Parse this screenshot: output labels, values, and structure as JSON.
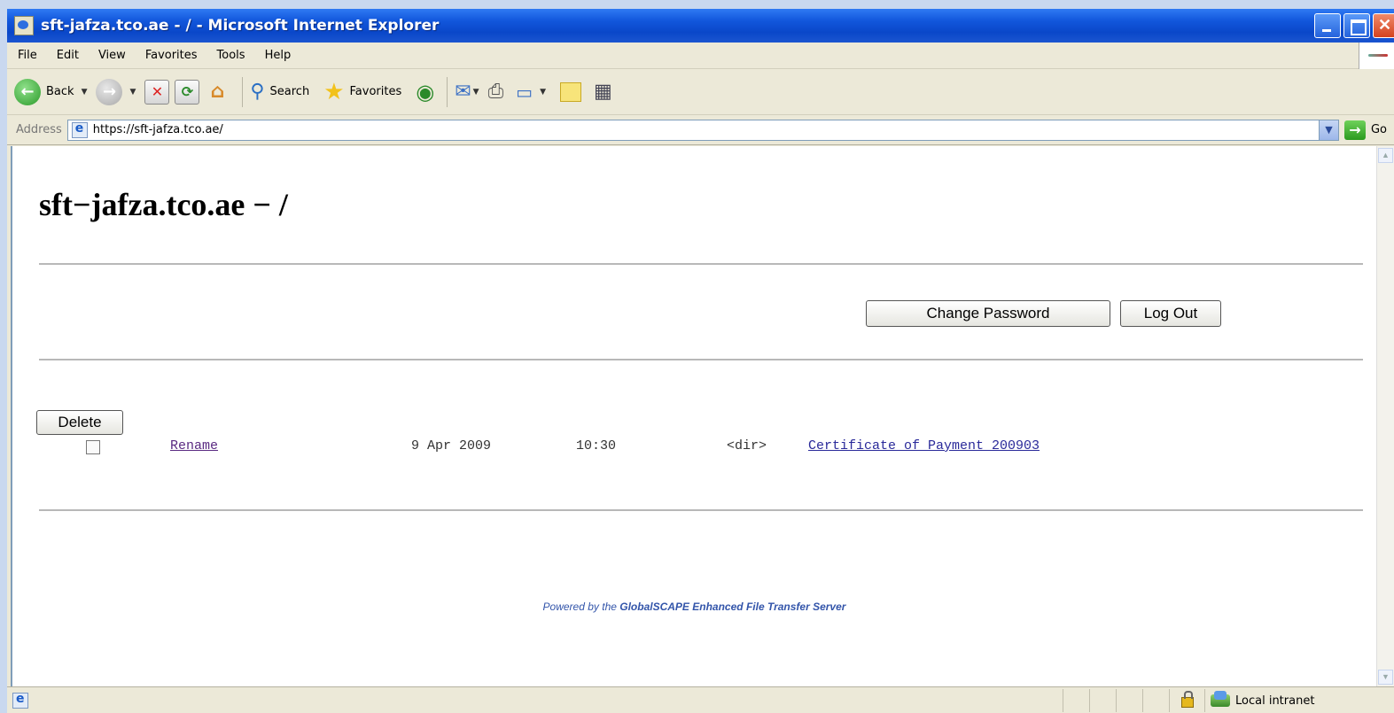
{
  "window": {
    "title": "sft-jafza.tco.ae - / - Microsoft Internet Explorer"
  },
  "menu": {
    "items": [
      {
        "label": "File"
      },
      {
        "label": "Edit"
      },
      {
        "label": "View"
      },
      {
        "label": "Favorites"
      },
      {
        "label": "Tools"
      },
      {
        "label": "Help"
      }
    ]
  },
  "toolbar": {
    "back_label": "Back",
    "search_label": "Search",
    "favorites_label": "Favorites"
  },
  "address": {
    "label": "Address",
    "url": "https://sft-jafza.tco.ae/",
    "go_label": "Go"
  },
  "page": {
    "heading": "sft−jafza.tco.ae − /",
    "change_password_label": "Change Password",
    "logout_label": "Log Out",
    "delete_label": "Delete",
    "files": [
      {
        "action": "Rename",
        "date": "9 Apr 2009",
        "time": "10:30",
        "type": "<dir>",
        "name": "Certificate of Payment 200903"
      }
    ],
    "footer_prefix": "Powered by the ",
    "footer_brand": "GlobalSCAPE Enhanced File Transfer Server"
  },
  "status": {
    "zone_label": "Local intranet"
  }
}
